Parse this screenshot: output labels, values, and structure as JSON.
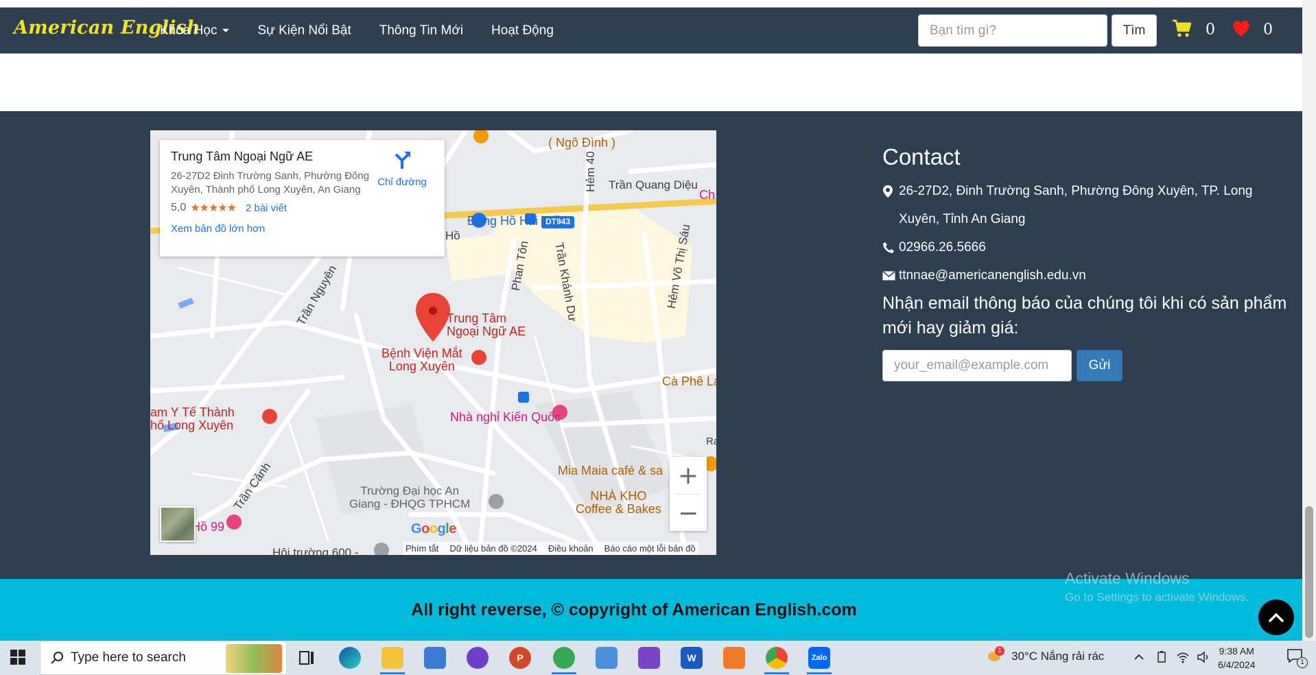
{
  "navbar": {
    "brand": "American English",
    "links": [
      "Khóa Học",
      "Sự Kiện Nổi Bật",
      "Thông Tin Mới",
      "Hoạt Động"
    ],
    "search_placeholder": "Bạn tìm gì?",
    "search_button": "Tìm",
    "cart_count": "0",
    "wishlist_count": "0"
  },
  "map": {
    "place_name": "Trung Tâm Ngoại Ngữ AE",
    "address": "26-27D2 Đinh Trường Sanh, Phường Đông Xuyên, Thành phố Long Xuyên, An Giang",
    "rating": "5,0",
    "stars": "★★★★★",
    "reviews": "2 bài viết",
    "larger_map_link": "Xem bản đồ lớn hơn",
    "directions": "Chỉ đường",
    "pin_label_1": "Trung Tâm",
    "pin_label_2": "Ngoại Ngữ AE",
    "labels": {
      "ngo_dinh": "( Ngô Đình )",
      "tran_quang_dieu": "Trần Quang Diệu",
      "dong_ho": "Đồng Hồ Hải Triều",
      "dt943": "DT943",
      "ho": "Hồ",
      "ch": "Ch",
      "hem40": "Hẻm 40",
      "phan_ton": "Phan Tôn",
      "tran_khanh_du": "Trần Khánh Dư",
      "hem_vo_thi_sau": "Hẻm Võ Thị Sáu",
      "tran_nguyen": "Trần Nguyên",
      "benh_vien_1": "Bệnh Viện Mắt",
      "benh_vien_2": "Long Xuyên",
      "ca_phe": "Cà Phê La",
      "y_te_1": "am Y Tế Thành",
      "y_te_2": "hố Long Xuyên",
      "nha_nghi": "Nhà nghỉ Kiến Quốc",
      "mia_maia": "Mia Maia café & sa",
      "nha_kho_1": "NHÀ KHO",
      "nha_kho_2": "Coffee & Bakes",
      "tran_canh": "Trần Cảnh",
      "dai_hoc_1": "Trường Đại học An",
      "dai_hoc_2": "Giang - ĐHQG TPHCM",
      "ho99": "Hồ 99",
      "hoi_truong": "Hội trường 600 -",
      "ra": "Ra"
    },
    "google": "Google",
    "footer": [
      "Phím tắt",
      "Dữ liệu bản đồ ©2024",
      "Điều khoản",
      "Báo cáo một lỗi bản đồ"
    ],
    "zoom_in": "+",
    "zoom_out": "−"
  },
  "contact": {
    "title": "Contact",
    "address": "26-27D2, Đinh Trường Sanh, Phường Đông Xuyên, TP. Long Xuyên, Tỉnh An Giang",
    "phone": "02966.26.5666",
    "email": "ttnnae@americanenglish.edu.vn",
    "newsletter": "Nhận email thông báo của chúng tôi khi có sản phẩm mới hay giảm giá:",
    "email_placeholder": "your_email@example.com",
    "send_button": "Gửi"
  },
  "footer": {
    "copyright": "All right reverse, © copyright of American English.com"
  },
  "windows_watermark": {
    "line1": "Activate Windows",
    "line2": "Go to Settings to activate Windows."
  },
  "taskbar": {
    "search_placeholder": "Type here to search",
    "weather": "30°C  Nắng rải rác",
    "weather_badge": "1",
    "time": "9:38 AM",
    "date": "6/4/2024",
    "notification_count": "1"
  },
  "colors": {
    "navbar_bg": "#2c3e50",
    "brand": "#f1e21a",
    "copyright_bar": "#00bcdc",
    "send_button": "#337ab7"
  }
}
